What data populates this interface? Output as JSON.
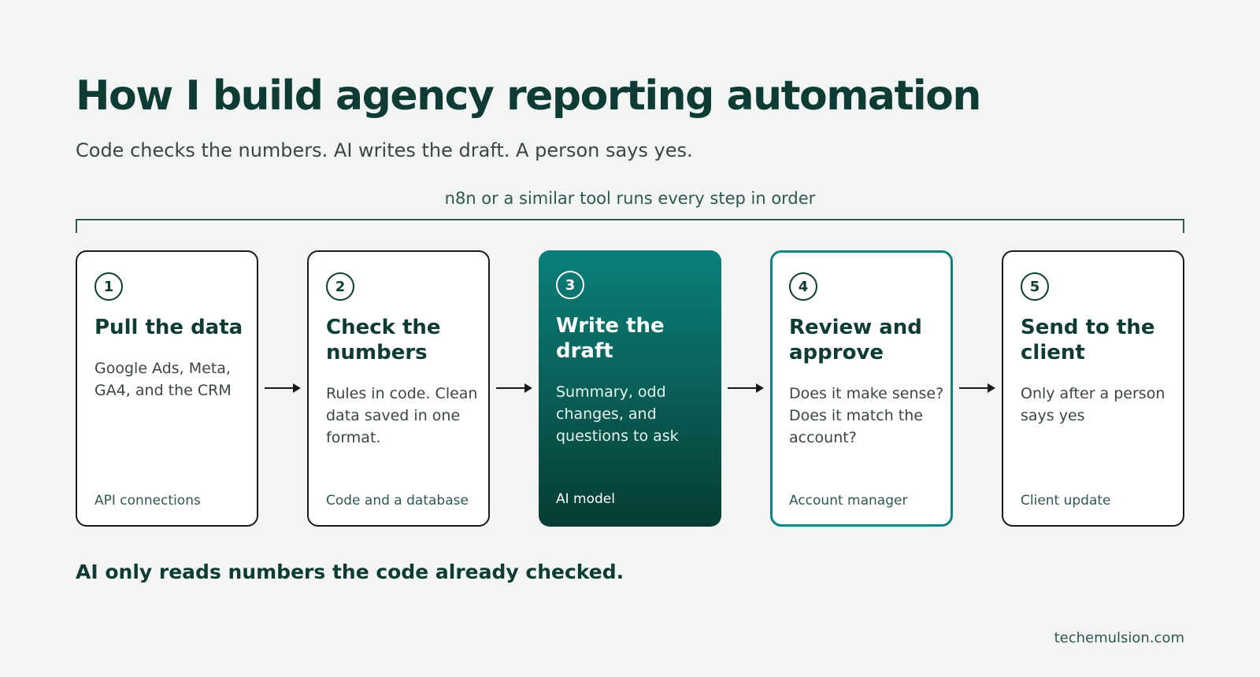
{
  "title": "How I build agency reporting automation",
  "subtitle": "Code checks the numbers. AI writes the draft. A person says yes.",
  "bracket_label": "n8n or a similar tool runs every step in order",
  "steps": [
    {
      "number": "1",
      "title": "Pull the data",
      "description": "Google Ads, Meta, GA4, and the CRM",
      "footer": "API connections"
    },
    {
      "number": "2",
      "title": "Check the numbers",
      "description": "Rules in code. Clean data saved in one format.",
      "footer": "Code and a database"
    },
    {
      "number": "3",
      "title": "Write the draft",
      "description": "Summary, odd changes, and questions to ask",
      "footer": "AI model"
    },
    {
      "number": "4",
      "title": "Review and approve",
      "description": "Does it make sense? Does it match the account?",
      "footer": "Account manager"
    },
    {
      "number": "5",
      "title": "Send to the client",
      "description": "Only after a person says yes",
      "footer": "Client update"
    }
  ],
  "footnote": "AI only reads numbers the code already checked.",
  "website": "techemulsion.com",
  "colors": {
    "text_dark": "#0e3b33",
    "accent_teal": "#0b8581",
    "highlight_gradient_top": "#0b7f7a",
    "highlight_gradient_bottom": "#063c33",
    "background": "#f3f5f4"
  }
}
